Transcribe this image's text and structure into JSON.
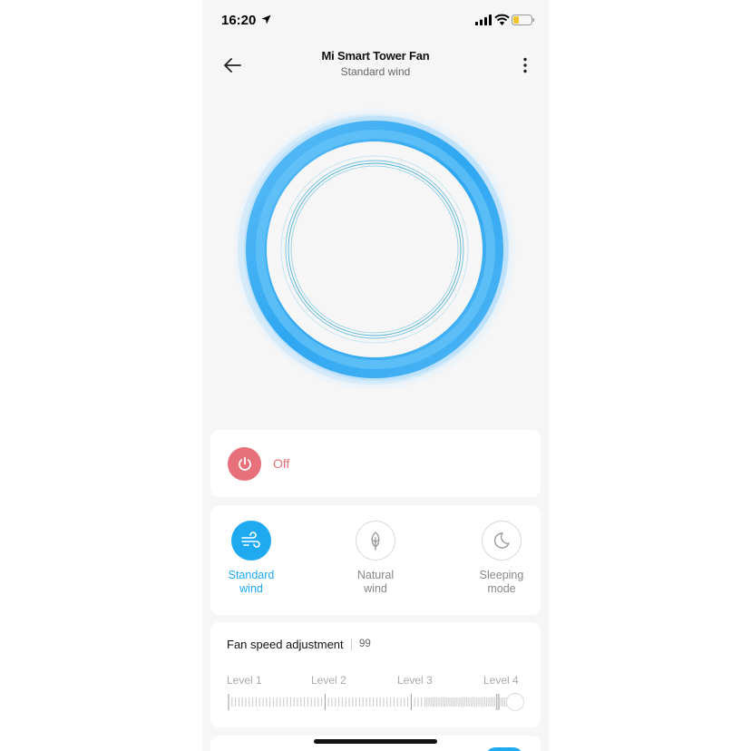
{
  "status_bar": {
    "time": "16:20"
  },
  "header": {
    "title": "Mi Smart Tower Fan",
    "subtitle": "Standard wind"
  },
  "power": {
    "label": "Off",
    "color": "#e8707b"
  },
  "modes": [
    {
      "label_line1": "Standard",
      "label_line2": "wind",
      "icon": "wind-icon",
      "active": true
    },
    {
      "label_line1": "Natural",
      "label_line2": "wind",
      "icon": "leaf-icon",
      "active": false
    },
    {
      "label_line1": "Sleeping",
      "label_line2": "mode",
      "icon": "moon-icon",
      "active": false
    }
  ],
  "speed": {
    "title": "Fan speed adjustment",
    "value": "99",
    "levels": [
      "Level 1",
      "Level 2",
      "Level 3",
      "Level 4"
    ]
  },
  "colors": {
    "accent": "#1ea9f1",
    "power": "#e8707b",
    "background": "#f6f6f6"
  }
}
